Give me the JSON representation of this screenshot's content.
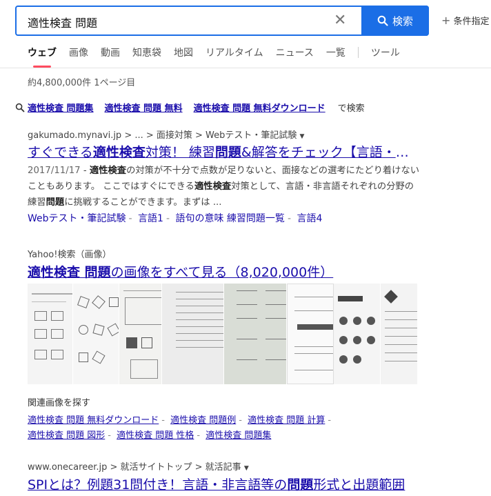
{
  "search": {
    "query": "適性検査 問題",
    "button_label": "検索",
    "conditions_label": "条件指定"
  },
  "tabs": [
    {
      "label": "ウェブ"
    },
    {
      "label": "画像"
    },
    {
      "label": "動画"
    },
    {
      "label": "知恵袋"
    },
    {
      "label": "地図"
    },
    {
      "label": "リアルタイム"
    },
    {
      "label": "ニュース"
    },
    {
      "label": "一覧"
    },
    {
      "label": "ツール"
    }
  ],
  "result_count": "約4,800,000件  1ページ目",
  "suggestions": {
    "items": [
      "適性検査 問題集",
      "適性検査 問題 無料",
      "適性検査 問題 無料ダウンロード"
    ],
    "suffix": "で検索"
  },
  "result1": {
    "breadcrumb": "gakumado.mynavi.jp > ... > 面接対策 > Webテスト・筆記試験",
    "title_parts": [
      "すぐできる",
      "適性検査",
      "対策！ 練習",
      "問題",
      "&解答をチェック【言語・非言語"
    ],
    "date": "2017/11/17",
    "snippet_parts": [
      " - ",
      "適性検査",
      "の対策が不十分で点数が足りないと、面接などの選考にたどり着けないこともあります。 ここではすぐにできる",
      "適性検査",
      "対策として、言語・非言語それぞれの分野の練習",
      "問題",
      "に挑戦することができます。まずは ..."
    ],
    "sitelinks": [
      "Webテスト・筆記試験",
      "言語1",
      "語句の意味 練習問題一覧",
      "言語4"
    ]
  },
  "images_block": {
    "source": "Yahoo!検索（画像）",
    "title_bold": "適性検査 問題",
    "title_rest": "の画像をすべて見る（8,020,000件）",
    "related_title": "関連画像を探す",
    "related": [
      "適性検査 問題 無料ダウンロード",
      "適性検査 問題例",
      "適性検査 問題 計算",
      "適性検査 問題 図形",
      "適性検査 問題 性格",
      "適性検査 問題集"
    ]
  },
  "result2": {
    "breadcrumb": "www.onecareer.jp > 就活サイトトップ > 就活記事",
    "title_parts": [
      "SPIとは？例題31問付き！言語・非言語等の",
      "問題",
      "形式と出題範囲"
    ]
  },
  "colors": {
    "accent": "#1b6ee6",
    "link": "#1a0dab",
    "tab_indicator": "#ff4b5f"
  }
}
